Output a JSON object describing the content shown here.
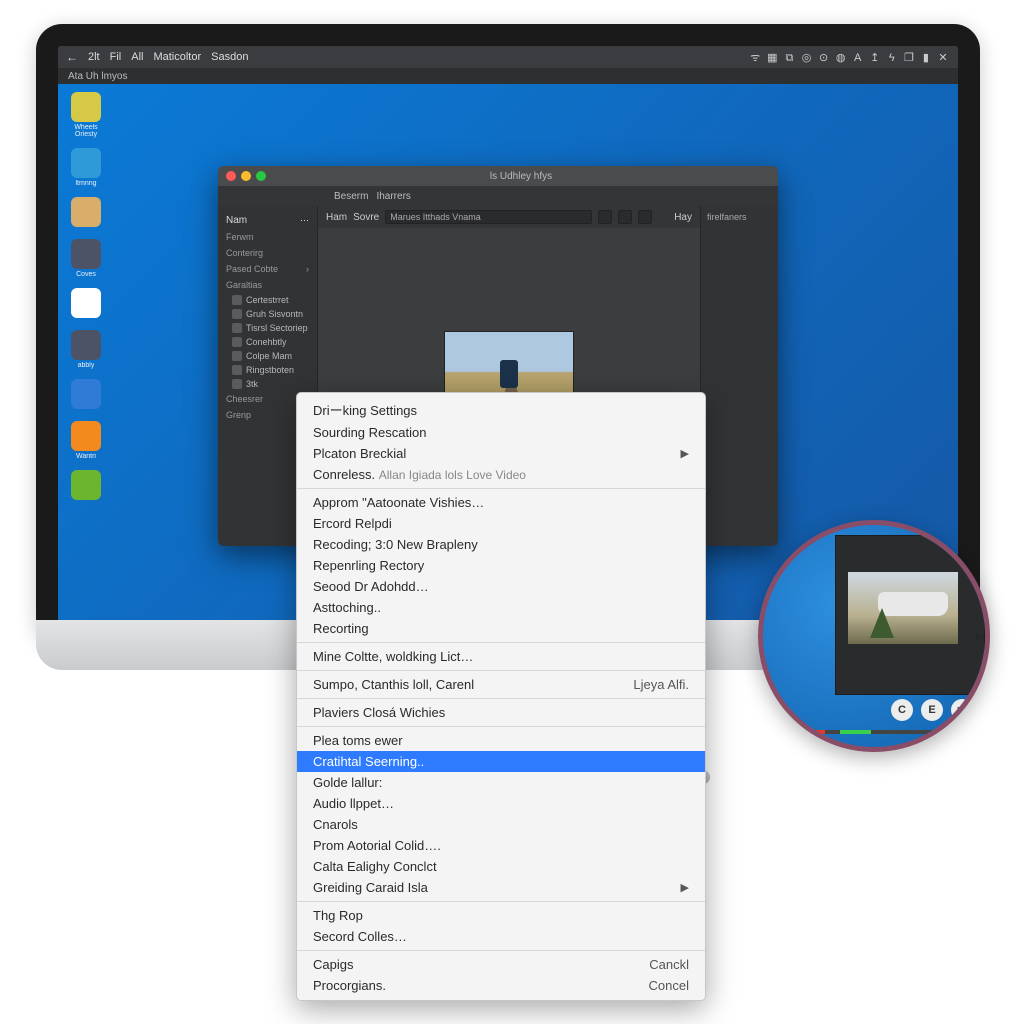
{
  "menubar": {
    "back_symbol": "←",
    "items": [
      "2lt",
      "Fil",
      "All",
      "Maticoltor",
      "Sasdon"
    ],
    "tray_icons": [
      "wifi-icon",
      "grid-icon",
      "screen-icon",
      "circle-icon",
      "record-icon",
      "globe-icon",
      "aa-icon",
      "up-icon",
      "antenna-icon",
      "window-icon",
      "panel-icon",
      "close-icon"
    ]
  },
  "subbar": {
    "text": "Ata Uh lmyos"
  },
  "desktop_icons": [
    {
      "label": "Wheels Oriesty",
      "color": "#d6c946"
    },
    {
      "label": "ltmnng",
      "color": "#2f9ad8"
    },
    {
      "label": "",
      "color": "#d8ae6a"
    },
    {
      "label": "Coves",
      "color": "#4d5366"
    },
    {
      "label": "",
      "color": "#ffffff"
    },
    {
      "label": "abbly",
      "color": "#4d5366"
    },
    {
      "label": "",
      "color": "#2f7bd6"
    },
    {
      "label": "Wantri",
      "color": "#f28a1e"
    },
    {
      "label": "",
      "color": "#6bb52f"
    }
  ],
  "app": {
    "title": "ls Udhley hfys",
    "tabs": [
      "Beserm",
      "Iharrers"
    ],
    "sidebar": {
      "header": "Nam",
      "sections": [
        {
          "label": "Ferwm"
        },
        {
          "label": "Conterirg"
        },
        {
          "label": "Pased Cobte",
          "expandable": true
        },
        {
          "label": "Garaltias"
        }
      ],
      "items": [
        "Certestrret",
        "Gruh Sisvontn",
        "Tisrsl Sectoriep",
        "Conehbtly",
        "Colpe Mam",
        "Ringstboten",
        "3tk"
      ],
      "sections2": [
        {
          "label": "Cheesrer"
        },
        {
          "label": "Grenp"
        }
      ]
    },
    "toolbar": {
      "label_main": "Ham",
      "label_source": "Sovre",
      "field_value": "Marues Itthads Vnama",
      "label_right": "Hay"
    },
    "rightpanel": {
      "header": "firelfaners"
    }
  },
  "context_menu": {
    "groups": [
      [
        {
          "label": "Driーking Settings"
        },
        {
          "label": "Sourding Rescation"
        },
        {
          "label": "Plcaton Breckial",
          "submenu": true
        },
        {
          "label": "Conreless.",
          "hint": "Allan Igiada lols Love Video"
        }
      ],
      [
        {
          "label": "Approm \"Aаtoonate Vishies…"
        },
        {
          "label": "Ercord Relpdi"
        },
        {
          "label": "Recoding; 3:0 New Brapleny",
          "hint_inline": true
        },
        {
          "label": "Repenrling Rеctory"
        },
        {
          "label": "Seood Dr Adohdd…"
        },
        {
          "label": "Asttoching.."
        },
        {
          "label": "Recorting"
        }
      ],
      [
        {
          "label": "Mine Coltte, woldking Lict…"
        }
      ],
      [
        {
          "label": "Sumpo, Ctanthis loll, Carenl",
          "right": "Ljeya Alfi."
        }
      ],
      [
        {
          "label": "Plaviers Closá Wichies"
        }
      ],
      [
        {
          "label": "Plea toms ewer"
        },
        {
          "label": "Cratihtal Seerning..",
          "highlight": true
        },
        {
          "label": "Golde lallur:"
        },
        {
          "label": "Audio llppet…"
        },
        {
          "label": "Cnarols"
        },
        {
          "label": "Prom Aotorial Colid…."
        },
        {
          "label": "Calta Ealighy Conclct"
        },
        {
          "label": "Greiding Caraid Isla",
          "submenu": true
        }
      ],
      [
        {
          "label": "Thg Rop"
        },
        {
          "label": "Secord Colles…"
        }
      ],
      [
        {
          "label": "Capigs",
          "right": "Canckl"
        },
        {
          "label": "Procorgians.",
          "right": "Concel"
        }
      ]
    ]
  },
  "zoom": {
    "ctrl_icons": [
      "C",
      "E",
      "▶"
    ],
    "bottom_icons": [
      "speaker-icon",
      "arrow-right-icon"
    ]
  }
}
